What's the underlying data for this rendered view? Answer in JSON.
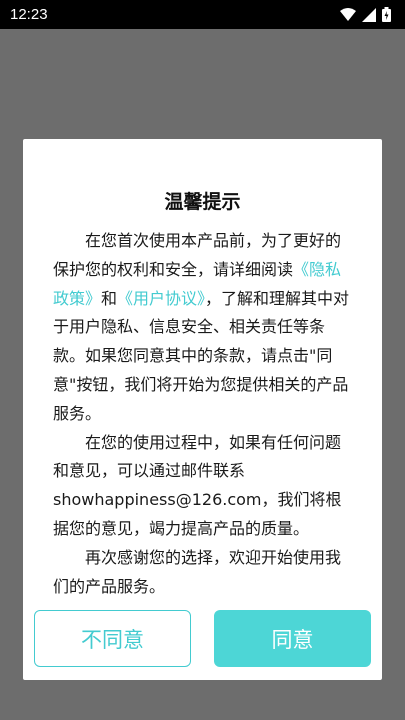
{
  "status_bar": {
    "time": "12:23",
    "icons": [
      "wifi-icon",
      "signal-icon",
      "battery-icon"
    ]
  },
  "dialog": {
    "title": "温馨提示",
    "paragraph1": {
      "text_a": "在您首次使用本产品前，为了更好的保护您的权利和安全，请详细阅读",
      "privacy_link": "《隐私政策》",
      "and": "和",
      "user_link": "《用户协议》",
      "text_b": "，了解和理解其中对于用户隐私、信息安全、相关责任等条款。如果您同意其中的条款，请点击\"同意\"按钮，我们将开始为您提供相关的产品服务。"
    },
    "paragraph2": "在您的使用过程中，如果有任何问题和意见，可以通过邮件联系showhappiness@126.com，我们将根据您的意见，竭力提高产品的质量。",
    "paragraph3": "再次感谢您的选择，欢迎开始使用我们的产品服务。",
    "decline_label": "不同意",
    "agree_label": "同意"
  },
  "colors": {
    "accent": "#43cbd0",
    "agree_bg": "#4dd6d6",
    "scrim": "#6d6d6d",
    "status_bar": "#000000"
  }
}
